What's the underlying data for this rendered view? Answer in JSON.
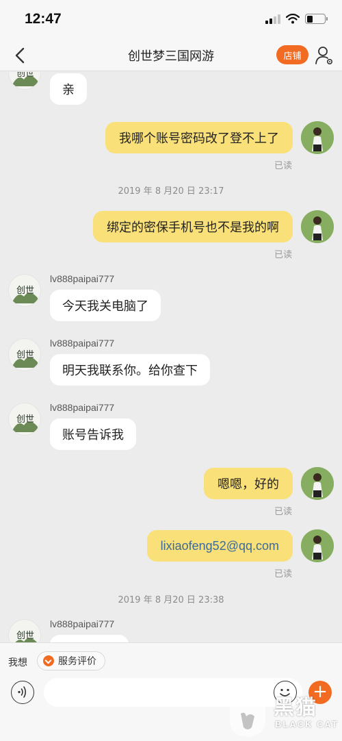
{
  "status_bar": {
    "time": "12:47"
  },
  "nav": {
    "title": "创世梦三国网游",
    "shop_label": "店铺"
  },
  "messages": {
    "m1": "亲",
    "m2": "我哪个账号密码改了登不上了",
    "m2_status": "已读",
    "ts1": "2019 年 8 月20 日 23:17",
    "m3": "绑定的密保手机号也不是我的啊",
    "m3_status": "已读",
    "seller_name": "lv888paipai777",
    "m4": "今天我关电脑了",
    "m5": "明天我联系你。给你查下",
    "m6": "账号告诉我",
    "m7": "嗯嗯，好的",
    "m7_status": "已读",
    "m8": "lixiaofeng52@qq.com",
    "m8_status": "已读",
    "ts2": "2019 年 8 月20 日 23:38"
  },
  "quick": {
    "label": "我想",
    "chip": "服务评价"
  },
  "input": {
    "placeholder": ""
  },
  "watermark": {
    "main": "黑猫",
    "sub": "BLACK CAT"
  },
  "colors": {
    "accent": "#f26b22",
    "buyer_bubble": "#f9e079",
    "seller_bubble": "#ffffff",
    "background": "#ececec"
  }
}
